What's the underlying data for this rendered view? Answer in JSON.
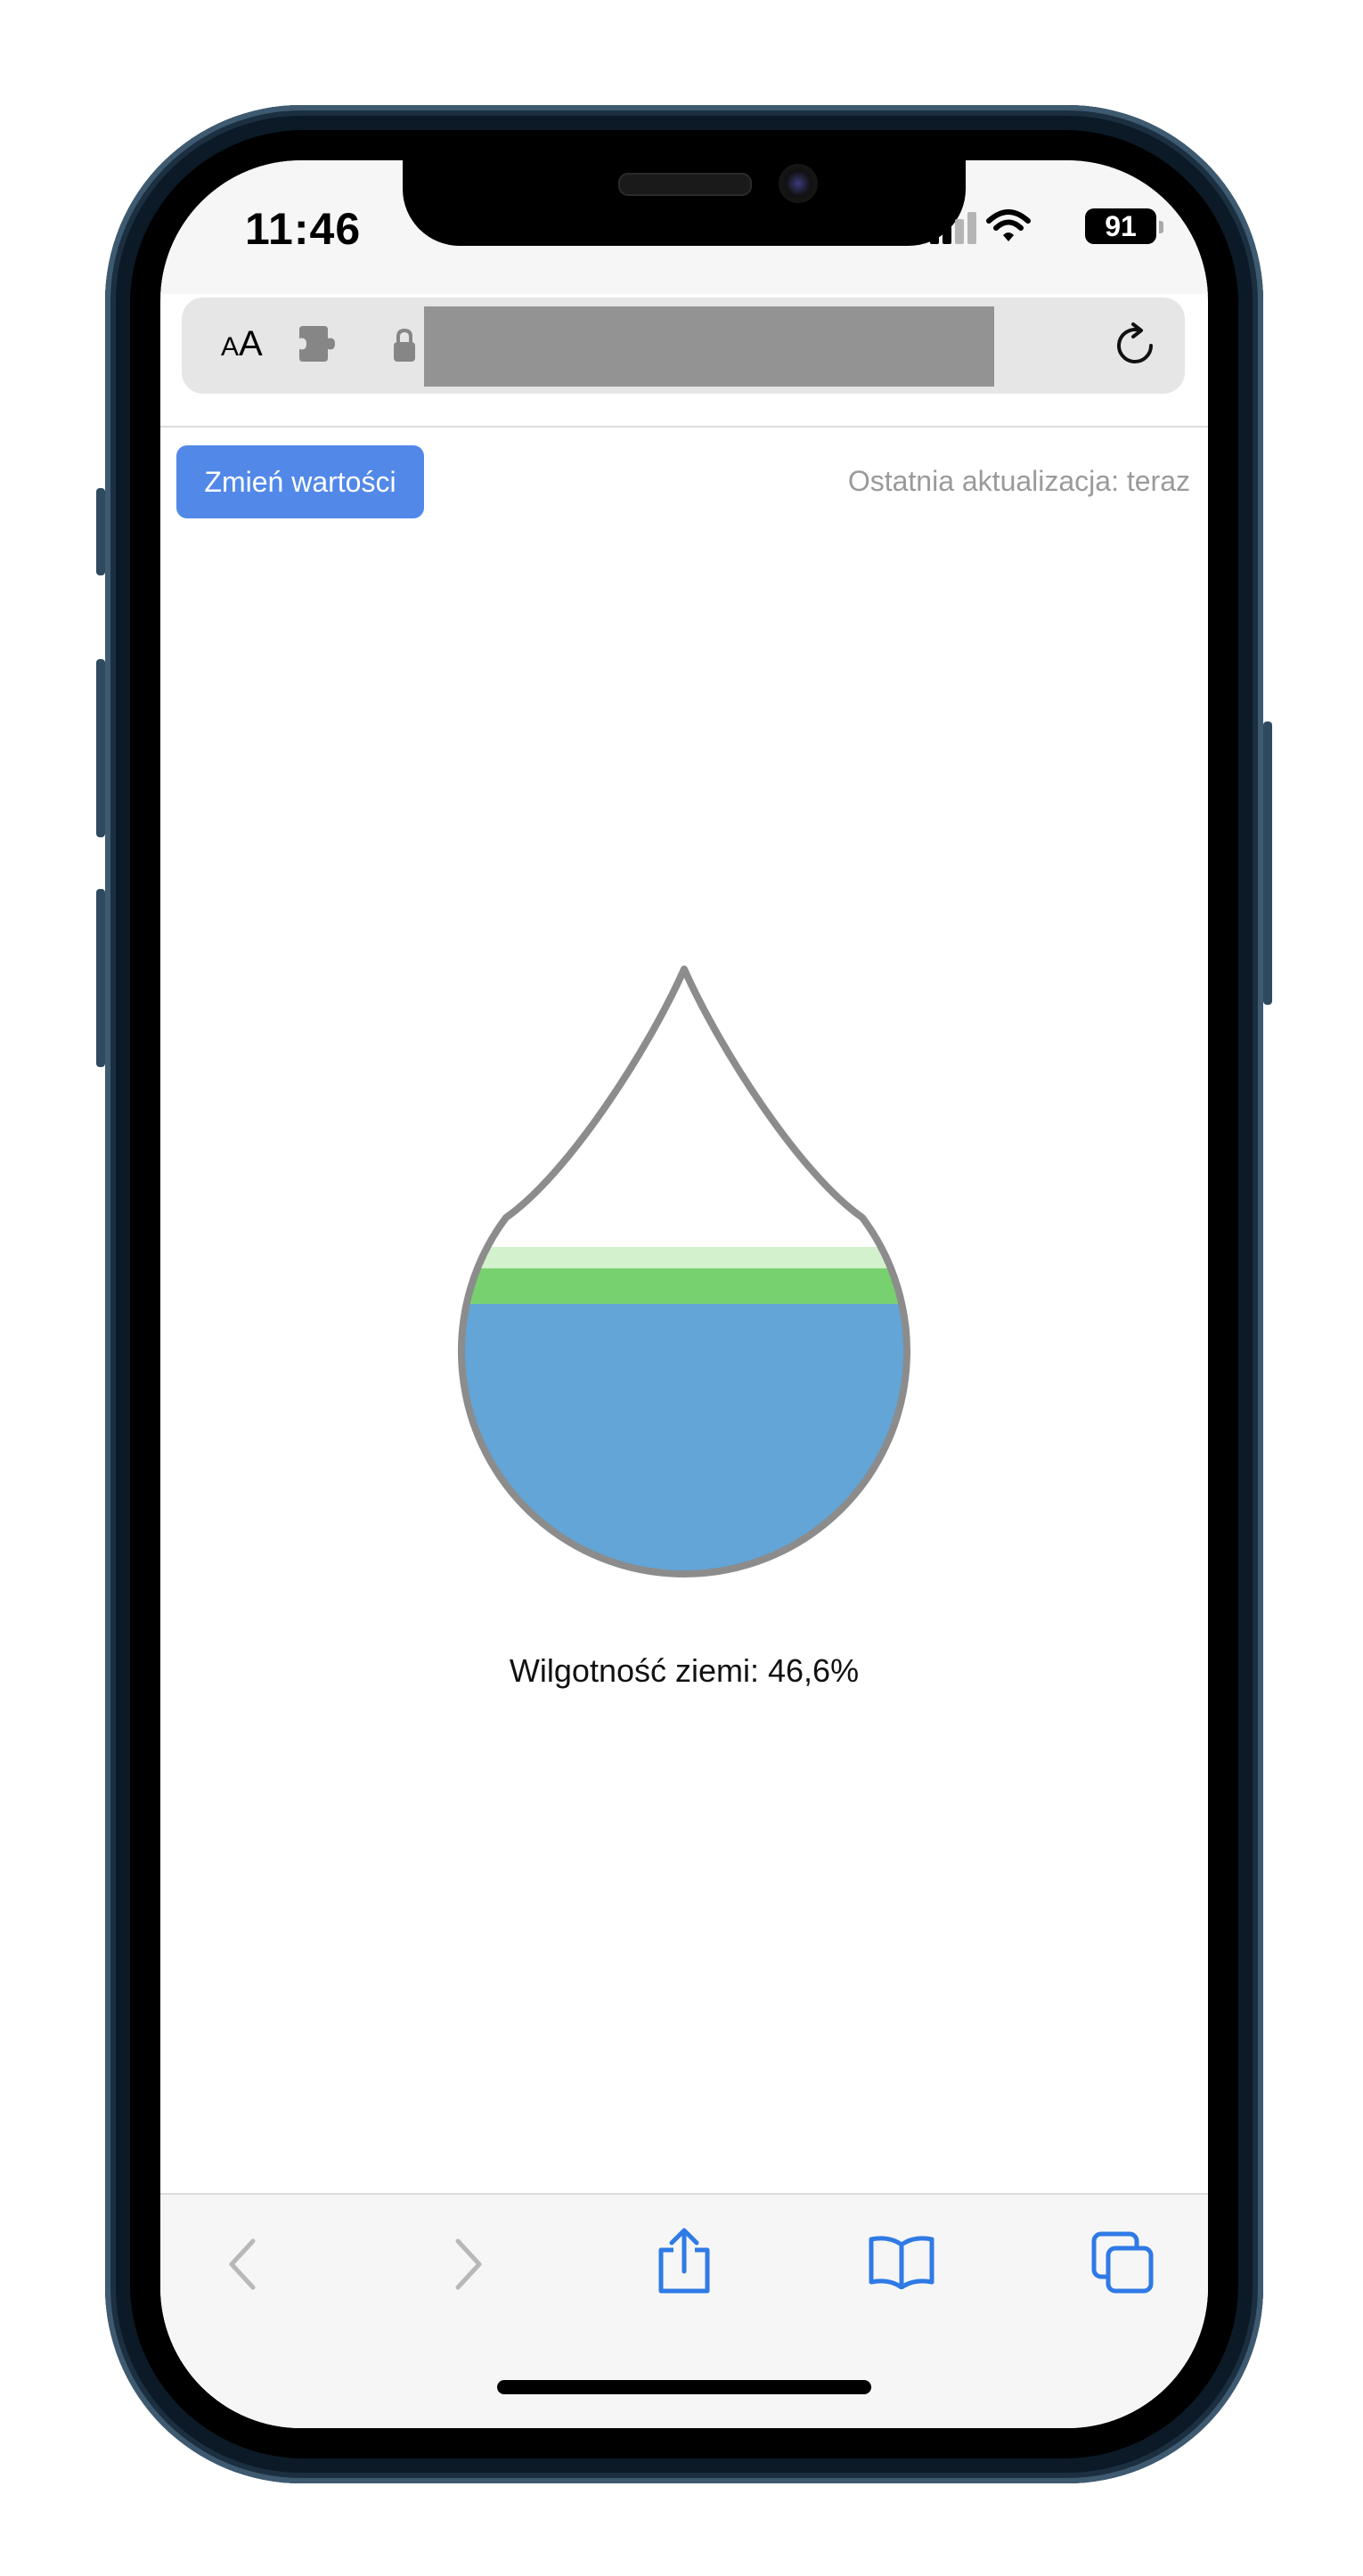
{
  "status_bar": {
    "time": "11:46",
    "battery": "91",
    "signal_bars_active": 2,
    "signal_bars_total": 4
  },
  "browser": {
    "text_size_label_small": "A",
    "text_size_label_large": "A",
    "icons": [
      "text-size-icon",
      "extension-icon",
      "lock-icon",
      "reload-icon"
    ],
    "toolbar_icons": [
      "back-icon",
      "forward-icon",
      "share-icon",
      "bookmarks-icon",
      "tabs-icon"
    ]
  },
  "page": {
    "change_button_label": "Zmień wartości",
    "last_update": "Ostatnia aktualizacja: teraz",
    "humidity_caption": "Wilgotność ziemi: 46,6%",
    "humidity_percent": 46.6
  },
  "colors": {
    "accent": "#5289e8",
    "water": "#62a5d6",
    "green": "#77d16f",
    "light_green": "#d3f1cc",
    "drop_outline": "#8c8c8c"
  }
}
